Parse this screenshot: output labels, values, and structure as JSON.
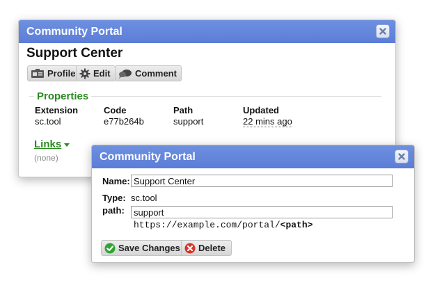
{
  "background_dialog": {
    "title": "Community Portal",
    "heading": "Support Center",
    "toolbar": {
      "profile_label": "Profile",
      "edit_label": "Edit",
      "comment_label": "Comment"
    },
    "properties": {
      "legend": "Properties",
      "columns": [
        {
          "header": "Extension",
          "value": "sc.tool"
        },
        {
          "header": "Code",
          "value": "e77b264b"
        },
        {
          "header": "Path",
          "value": "support"
        },
        {
          "header": "Updated",
          "value": "22 mins ago"
        }
      ]
    },
    "links": {
      "label": "Links",
      "empty_text": "(none)"
    }
  },
  "edit_dialog": {
    "title": "Community Portal",
    "name_label": "Name:",
    "name_value": "Support Center",
    "type_label": "Type:",
    "type_value": "sc.tool",
    "path_label": "path:",
    "path_value": "support",
    "path_hint_prefix": "https://example.com/portal/",
    "path_hint_token": "<path>",
    "save_label": "Save Changes",
    "delete_label": "Delete"
  },
  "colors": {
    "titlebar": "#5b7dd6",
    "accent_green": "#2a8a1e",
    "save_icon": "#2fa52f",
    "delete_icon": "#d9342b"
  }
}
